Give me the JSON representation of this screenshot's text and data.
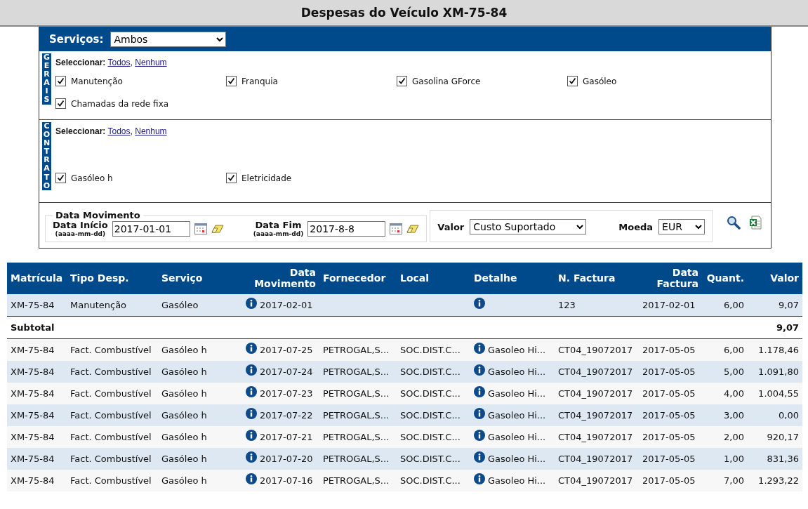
{
  "title": "Despesas do Veículo XM-75-84",
  "services": {
    "label": "Serviços:",
    "value": "Ambos"
  },
  "groups": [
    {
      "label": "GERAIS",
      "select_label": "Seleccionar:",
      "links": [
        "Todos",
        "Nenhum"
      ],
      "separator": ",",
      "items": [
        {
          "label": "Manutenção",
          "checked": true
        },
        {
          "label": "Franquia",
          "checked": true
        },
        {
          "label": "Gasolina GForce",
          "checked": true
        },
        {
          "label": "Gasóleo",
          "checked": true
        },
        {
          "label": "Chamadas da rede fixa",
          "checked": true
        }
      ]
    },
    {
      "label": "CONTRATO",
      "select_label": "Seleccionar:",
      "links": [
        "Todos",
        "Nenhum"
      ],
      "separator": ",",
      "items": [
        {
          "label": "Gasóleo h",
          "checked": true
        },
        {
          "label": "Eletricidade",
          "checked": true
        }
      ]
    }
  ],
  "date_filter": {
    "legend": "Data Movimento",
    "start": {
      "label": "Data Início",
      "hint": "(aaaa-mm-dd)",
      "value": "2017-01-01"
    },
    "end": {
      "label": "Data Fim",
      "hint": "(aaaa-mm-dd)",
      "value": "2017-8-8"
    }
  },
  "value_filter": {
    "label": "Valor",
    "value": "Custo Suportado"
  },
  "currency_filter": {
    "label": "Moeda",
    "value": "EUR"
  },
  "table": {
    "columns": [
      "Matrícula",
      "Tipo Desp.",
      "Serviço",
      "Data Movimento",
      "Fornecedor",
      "Local",
      "Detalhe",
      "N. Factura",
      "Data Factura",
      "Quant.",
      "Valor"
    ],
    "groups": [
      {
        "rows": [
          {
            "plate": "XM-75-84",
            "type": "Manutenção",
            "service": "Gasóleo",
            "date": "2017-02-01",
            "invoice": "123",
            "invoice_date": "2017-02-01",
            "qty": "6,00",
            "value": "9,07"
          }
        ],
        "subtotal": {
          "label": "Subtotal",
          "value": "9,07"
        }
      },
      {
        "rows": [
          {
            "plate": "XM-75-84",
            "type": "Fact. Combustível",
            "service": "Gasóleo h",
            "date": "2017-07-25",
            "supplier": "PETROGAL,S...",
            "place": "SOC.DIST.C...",
            "detail": "Gasoleo Hi...",
            "invoice": "CT04_19072017",
            "invoice_date": "2017-05-05",
            "qty": "6,00",
            "value": "1.178,46"
          },
          {
            "plate": "XM-75-84",
            "type": "Fact. Combustível",
            "service": "Gasóleo h",
            "date": "2017-07-24",
            "supplier": "PETROGAL,S...",
            "place": "SOC.DIST.C...",
            "detail": "Gasoleo Hi...",
            "invoice": "CT04_19072017",
            "invoice_date": "2017-05-05",
            "qty": "5,00",
            "value": "1.091,80"
          },
          {
            "plate": "XM-75-84",
            "type": "Fact. Combustível",
            "service": "Gasóleo h",
            "date": "2017-07-23",
            "supplier": "PETROGAL,S...",
            "place": "SOC.DIST.C...",
            "detail": "Gasoleo Hi...",
            "invoice": "CT04_19072017",
            "invoice_date": "2017-05-05",
            "qty": "4,00",
            "value": "1.004,55"
          },
          {
            "plate": "XM-75-84",
            "type": "Fact. Combustível",
            "service": "Gasóleo h",
            "date": "2017-07-22",
            "supplier": "PETROGAL,S...",
            "place": "SOC.DIST.C...",
            "detail": "Gasoleo Hi...",
            "invoice": "CT04_19072017",
            "invoice_date": "2017-05-05",
            "qty": "3,00",
            "value": "0,00"
          },
          {
            "plate": "XM-75-84",
            "type": "Fact. Combustível",
            "service": "Gasóleo h",
            "date": "2017-07-21",
            "supplier": "PETROGAL,S...",
            "place": "SOC.DIST.C...",
            "detail": "Gasoleo Hi...",
            "invoice": "CT04_19072017",
            "invoice_date": "2017-05-05",
            "qty": "2,00",
            "value": "920,17"
          },
          {
            "plate": "XM-75-84",
            "type": "Fact. Combustível",
            "service": "Gasóleo h",
            "date": "2017-07-20",
            "supplier": "PETROGAL,S...",
            "place": "SOC.DIST.C...",
            "detail": "Gasoleo Hi...",
            "invoice": "CT04_19072017",
            "invoice_date": "2017-05-05",
            "qty": "1,00",
            "value": "831,36"
          },
          {
            "plate": "XM-75-84",
            "type": "Fact. Combustível",
            "service": "Gasóleo h",
            "date": "2017-07-16",
            "supplier": "PETROGAL,S...",
            "place": "SOC.DIST.C...",
            "detail": "Gasoleo Hi...",
            "invoice": "CT04_19072017",
            "invoice_date": "2017-05-05",
            "qty": "7,00",
            "value": "1.293,22"
          }
        ]
      }
    ]
  }
}
